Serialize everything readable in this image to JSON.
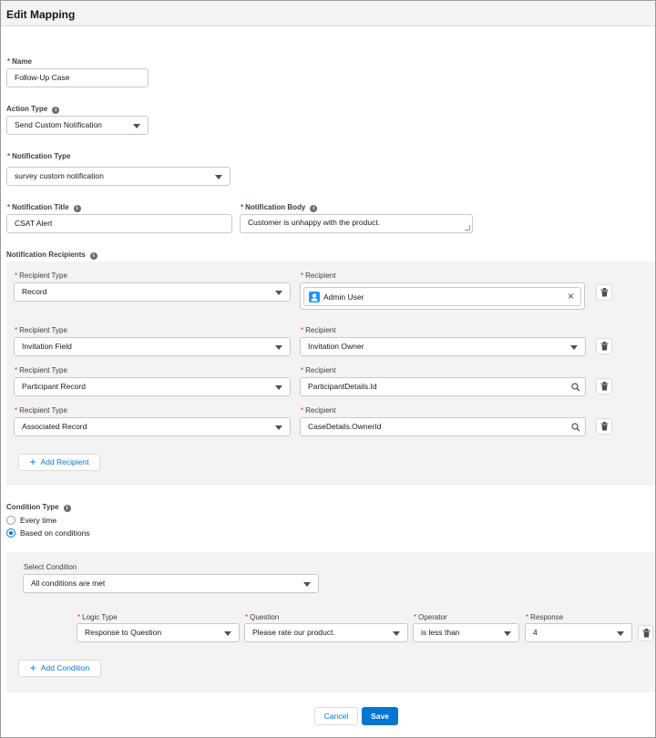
{
  "header": {
    "title": "Edit Mapping"
  },
  "name": {
    "label": "Name",
    "value": "Follow-Up Case"
  },
  "action_type": {
    "label": "Action Type",
    "value": "Send Custom Notification"
  },
  "notification_type": {
    "label": "Notification Type",
    "value": "survey custom notification"
  },
  "notification_title": {
    "label": "Notification Title",
    "value": "CSAT Alert"
  },
  "notification_body": {
    "label": "Notification Body",
    "value": "Customer is unhappy with the product."
  },
  "recipients": {
    "label": "Notification Recipients",
    "rows": [
      {
        "type_label": "Recipient Type",
        "type_value": "Record",
        "recipient_label": "Recipient",
        "recipient_value": "Admin User"
      },
      {
        "type_label": "Recipient Type",
        "type_value": "Invitation Field",
        "recipient_label": "Recipient",
        "recipient_value": "Invitation Owner"
      },
      {
        "type_label": "Recipient Type",
        "type_value": "Participant Record",
        "recipient_label": "Recipient",
        "recipient_value": "ParticipantDetails.Id"
      },
      {
        "type_label": "Recipient Type",
        "type_value": "Associated Record",
        "recipient_label": "Recipient",
        "recipient_value": "CaseDetails.OwnerId"
      }
    ],
    "add_label": "Add Recipient"
  },
  "condition_type": {
    "label": "Condition Type",
    "options": [
      "Every time",
      "Based on conditions"
    ],
    "selected": "Based on conditions"
  },
  "conditions": {
    "select_label": "Select Condition",
    "select_value": "All conditions are met",
    "logic_type_label": "Logic Type",
    "logic_type_value": "Response to Question",
    "question_label": "Question",
    "question_value": "Please rate our product.",
    "operator_label": "Operator",
    "operator_value": "is less than",
    "response_label": "Response",
    "response_value": "4",
    "add_label": "Add Condition"
  },
  "footer": {
    "cancel_label": "Cancel",
    "save_label": "Save"
  },
  "colors": {
    "brand": "#0176d3",
    "required": "#c23934",
    "section_bg": "#f3f3f3",
    "avatar": "#1b96ff"
  }
}
